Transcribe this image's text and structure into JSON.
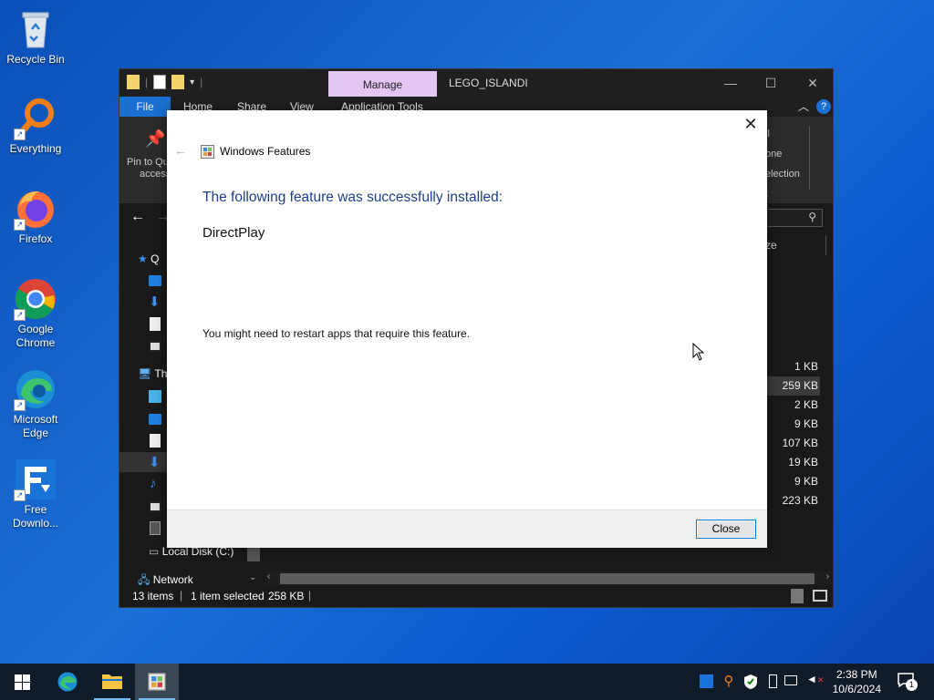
{
  "desktop": {
    "icons": [
      {
        "label": "Recycle Bin",
        "icon": "recycle-bin-icon"
      },
      {
        "label": "Everything",
        "icon": "everything-search-icon"
      },
      {
        "label": "Firefox",
        "icon": "firefox-icon"
      },
      {
        "label": "Google Chrome",
        "icon": "chrome-icon"
      },
      {
        "label": "Microsoft Edge",
        "icon": "edge-icon"
      },
      {
        "label": "Free Downlo...",
        "icon": "free-download-manager-icon"
      }
    ]
  },
  "explorer": {
    "contextual_tab": "Manage",
    "window_title": "LEGO_ISLANDI",
    "ribbon_tabs": [
      "File",
      "Home",
      "Share",
      "View",
      "Application Tools"
    ],
    "ribbon_left": {
      "line1": "Pin to Qu",
      "line2": "access"
    },
    "ribbon_right": [
      "ll",
      "one",
      "election",
      "t"
    ],
    "column_fragment": "ze",
    "nav_items": [
      "Q",
      "Th",
      "Local Disk (C:)",
      "Network"
    ],
    "file_sizes": [
      "1 KB",
      "259 KB",
      "2 KB",
      "9 KB",
      "107 KB",
      "19 KB",
      "9 KB",
      "223 KB"
    ],
    "selected_size_index": 1,
    "status": {
      "item_count": "13 items",
      "selection": "1 item selected",
      "size": "258 KB"
    }
  },
  "dialog": {
    "title": "Windows Features",
    "heading": "The following feature was successfully installed:",
    "feature": "DirectPlay",
    "note": "You might need to restart apps that require this feature.",
    "close_button": "Close"
  },
  "taskbar": {
    "clock_time": "2:38 PM",
    "clock_date": "10/6/2024",
    "notification_count": "1"
  },
  "colors": {
    "accent": "#0078d7",
    "manage_tab": "#e3c6f2",
    "heading_blue": "#1e3e8c"
  }
}
